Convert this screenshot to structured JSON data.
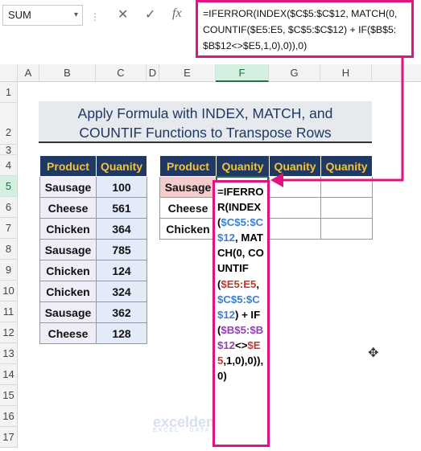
{
  "name_box": {
    "value": "SUM",
    "dropdown_icon": "chevron-down-icon"
  },
  "formula_bar": {
    "cancel_icon": "close-icon",
    "enter_icon": "check-icon",
    "fx_label": "fx",
    "formula": "=IFERROR(INDEX($C$5:$C$12, MATCH(0, COUNTIF($E5:E5, $C$5:$C$12) + IF($B$5: $B$12<>$E5,1,0),0)),0)"
  },
  "columns": [
    "A",
    "B",
    "C",
    "D",
    "E",
    "F",
    "G",
    "H"
  ],
  "selected_column": "F",
  "rows": [
    "1",
    "2",
    "3",
    "4",
    "5",
    "6",
    "7",
    "8",
    "9",
    "10",
    "11",
    "12",
    "13",
    "14",
    "15",
    "16",
    "17"
  ],
  "selected_row": "5",
  "title": {
    "line1": "Apply Formula with INDEX, MATCH, and",
    "line2": "COUNTIF Functions to Transpose Rows"
  },
  "source_table": {
    "headers": [
      "Product",
      "Quanity"
    ],
    "rows": [
      [
        "Sausage",
        "100"
      ],
      [
        "Cheese",
        "561"
      ],
      [
        "Chicken",
        "364"
      ],
      [
        "Sausage",
        "785"
      ],
      [
        "Chicken",
        "124"
      ],
      [
        "Chicken",
        "324"
      ],
      [
        "Sausage",
        "362"
      ],
      [
        "Cheese",
        "128"
      ]
    ]
  },
  "result_table": {
    "headers": [
      "Product",
      "Quanity",
      "Quanity",
      "Quanity"
    ],
    "rows": [
      [
        "Sausage"
      ],
      [
        "Cheese"
      ],
      [
        "Chicken"
      ]
    ]
  },
  "cell_overlay": {
    "parts": [
      "=IFERROR(",
      "INDEX(",
      "$C$5:$C$12",
      ", MATCH(0, COUNTIF(",
      "$E5:",
      "E5",
      ", ",
      "$C$5:$C$12",
      ") + IF(",
      "$B$5:$B$12",
      "<>",
      "$E5",
      ",1,0),0)),0)"
    ]
  },
  "watermark": {
    "brand": "exceldemy",
    "tagline": "EXCEL · DATA · BI"
  },
  "colors": {
    "accent": "#e0137f",
    "header_bg": "#1f3864",
    "header_text": "#f4c430",
    "excel_green": "#217346"
  }
}
